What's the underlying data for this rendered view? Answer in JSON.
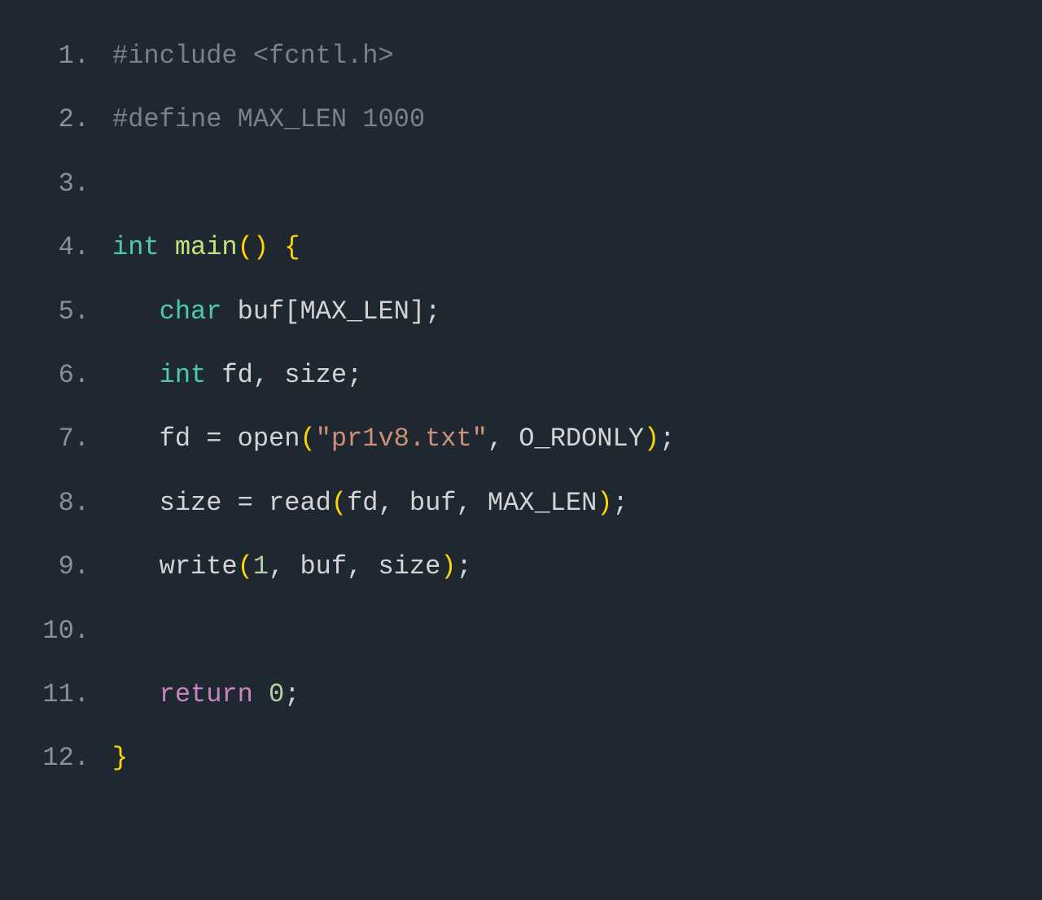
{
  "lines": [
    {
      "num": "1.",
      "tokens": [
        {
          "cls": "preprocessor",
          "text": "#include <fcntl.h>"
        }
      ]
    },
    {
      "num": "2.",
      "tokens": [
        {
          "cls": "preprocessor",
          "text": "#define MAX_LEN 1000"
        }
      ]
    },
    {
      "num": "3.",
      "tokens": []
    },
    {
      "num": "4.",
      "tokens": [
        {
          "cls": "keyword-type",
          "text": "int"
        },
        {
          "cls": "punct",
          "text": " "
        },
        {
          "cls": "main-fn",
          "text": "main"
        },
        {
          "cls": "paren",
          "text": "()"
        },
        {
          "cls": "punct",
          "text": " "
        },
        {
          "cls": "brace",
          "text": "{"
        }
      ]
    },
    {
      "num": "5.",
      "tokens": [
        {
          "cls": "punct",
          "text": "   "
        },
        {
          "cls": "keyword-type",
          "text": "char"
        },
        {
          "cls": "identifier",
          "text": " buf[MAX_LEN];"
        }
      ]
    },
    {
      "num": "6.",
      "tokens": [
        {
          "cls": "punct",
          "text": "   "
        },
        {
          "cls": "keyword-type",
          "text": "int"
        },
        {
          "cls": "identifier",
          "text": " fd, size;"
        }
      ]
    },
    {
      "num": "7.",
      "tokens": [
        {
          "cls": "identifier",
          "text": "   fd "
        },
        {
          "cls": "operator",
          "text": "="
        },
        {
          "cls": "identifier",
          "text": " open"
        },
        {
          "cls": "paren",
          "text": "("
        },
        {
          "cls": "string",
          "text": "\"pr1v8.txt\""
        },
        {
          "cls": "identifier",
          "text": ", O_RDONLY"
        },
        {
          "cls": "paren",
          "text": ")"
        },
        {
          "cls": "punct",
          "text": ";"
        }
      ]
    },
    {
      "num": "8.",
      "tokens": [
        {
          "cls": "identifier",
          "text": "   size "
        },
        {
          "cls": "operator",
          "text": "="
        },
        {
          "cls": "identifier",
          "text": " read"
        },
        {
          "cls": "paren",
          "text": "("
        },
        {
          "cls": "identifier",
          "text": "fd, buf, MAX_LEN"
        },
        {
          "cls": "paren",
          "text": ")"
        },
        {
          "cls": "punct",
          "text": ";"
        }
      ]
    },
    {
      "num": "9.",
      "tokens": [
        {
          "cls": "identifier",
          "text": "   write"
        },
        {
          "cls": "paren",
          "text": "("
        },
        {
          "cls": "number",
          "text": "1"
        },
        {
          "cls": "identifier",
          "text": ", buf, size"
        },
        {
          "cls": "paren",
          "text": ")"
        },
        {
          "cls": "punct",
          "text": ";"
        }
      ]
    },
    {
      "num": "10.",
      "tokens": []
    },
    {
      "num": "11.",
      "tokens": [
        {
          "cls": "punct",
          "text": "   "
        },
        {
          "cls": "keyword-control",
          "text": "return"
        },
        {
          "cls": "punct",
          "text": " "
        },
        {
          "cls": "number",
          "text": "0"
        },
        {
          "cls": "punct",
          "text": ";"
        }
      ]
    },
    {
      "num": "12.",
      "tokens": [
        {
          "cls": "brace",
          "text": "}"
        }
      ]
    }
  ]
}
